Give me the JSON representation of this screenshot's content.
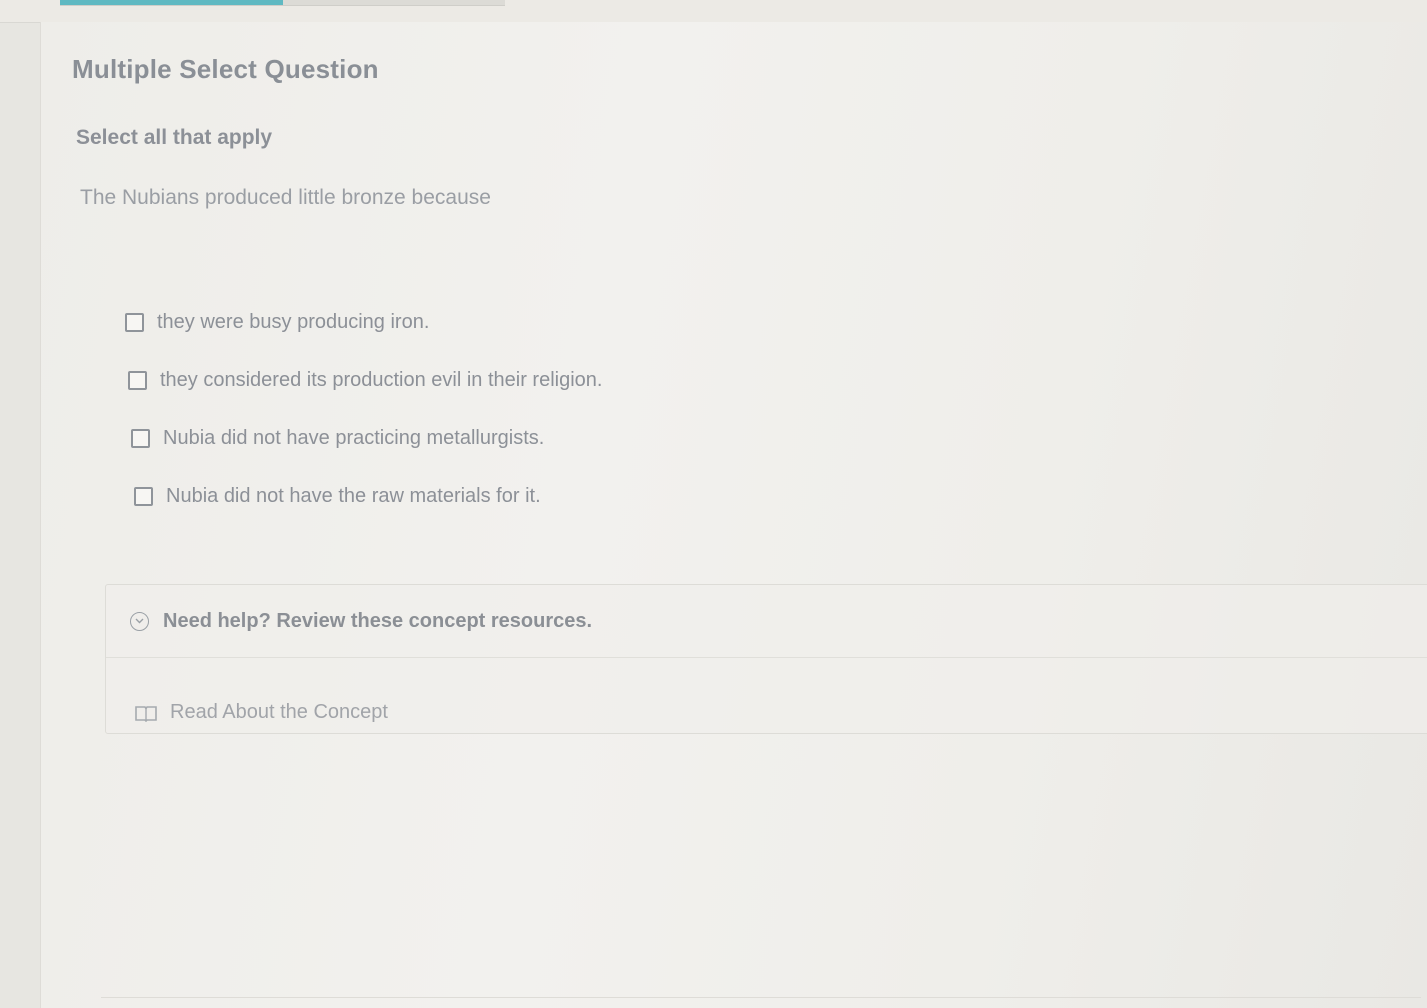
{
  "progress": {
    "fraction": 0.5
  },
  "question": {
    "type_label": "Multiple Select Question",
    "instruction": "Select all that apply",
    "prompt": "The Nubians produced little bronze because"
  },
  "options": [
    {
      "label": "they were busy producing iron.",
      "checked": false
    },
    {
      "label": "they considered its production evil in their religion.",
      "checked": false
    },
    {
      "label": "Nubia did not have practicing metallurgists.",
      "checked": false
    },
    {
      "label": "Nubia did not have the raw materials for it.",
      "checked": false
    }
  ],
  "help": {
    "title": "Need help? Review these concept resources.",
    "toggle_icon": "chevron-down-circle-icon",
    "links": [
      {
        "label": "Read About the Concept",
        "icon": "book-icon"
      }
    ]
  },
  "colors": {
    "accent": "#5fb9c2",
    "text": "#8c9097"
  }
}
